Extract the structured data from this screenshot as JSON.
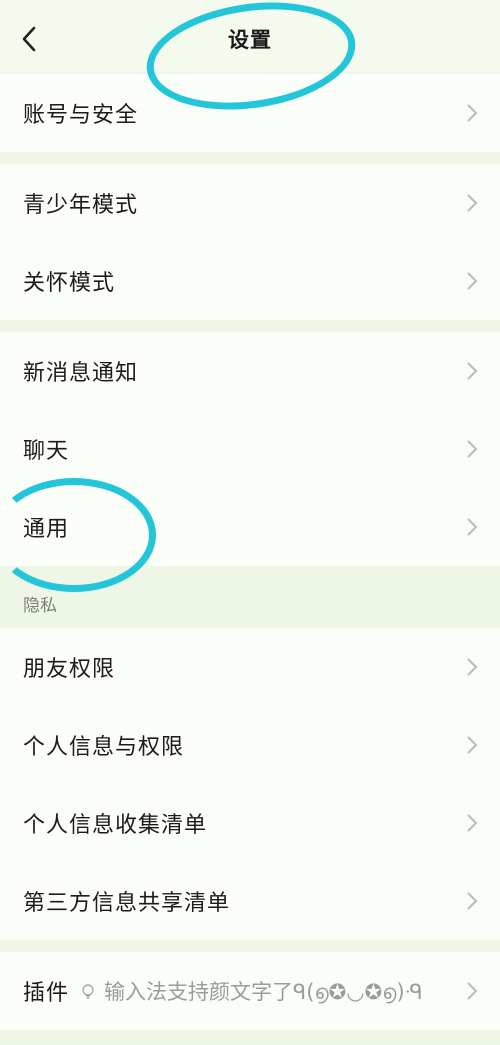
{
  "header": {
    "title": "设置"
  },
  "groups": [
    {
      "items": [
        {
          "label": "账号与安全"
        }
      ]
    },
    {
      "items": [
        {
          "label": "青少年模式"
        },
        {
          "label": "关怀模式"
        }
      ]
    },
    {
      "items": [
        {
          "label": "新消息通知"
        },
        {
          "label": "聊天"
        },
        {
          "label": "通用"
        }
      ]
    },
    {
      "section_label": "隐私",
      "items": [
        {
          "label": "朋友权限"
        },
        {
          "label": "个人信息与权限"
        },
        {
          "label": "个人信息收集清单"
        },
        {
          "label": "第三方信息共享清单"
        }
      ]
    },
    {
      "items": [
        {
          "label": "插件",
          "note": "输入法支持颜文字了ᑫ(൭✪◡✪൭)ᑴ"
        }
      ]
    }
  ],
  "annotation_color": "#22c6d8",
  "icons": {
    "back": "chevron-left-icon",
    "row": "chevron-right-icon",
    "plugin_note": "lightbulb-icon"
  }
}
